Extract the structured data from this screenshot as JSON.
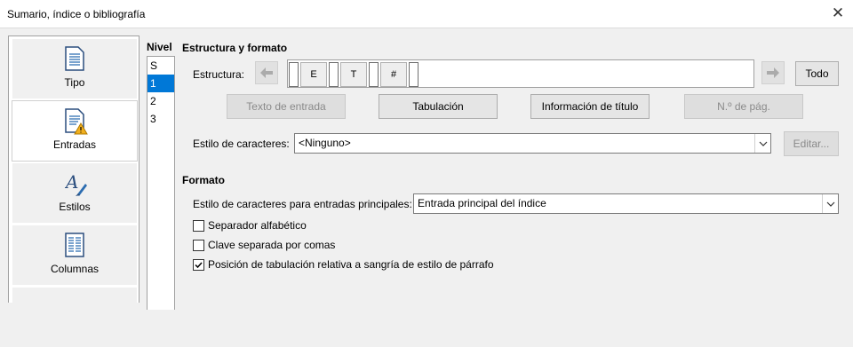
{
  "window": {
    "title": "Sumario, índice o bibliografía",
    "close_glyph": "✕"
  },
  "sidebar": {
    "items": [
      {
        "label": "Tipo",
        "icon": "document-icon"
      },
      {
        "label": "Entradas",
        "icon": "entries-warning-icon"
      },
      {
        "label": "Estilos",
        "icon": "styles-brush-icon"
      },
      {
        "label": "Columnas",
        "icon": "columns-icon"
      }
    ],
    "selected": "Entradas"
  },
  "levels": {
    "header": "Nivel",
    "items": [
      "S",
      "1",
      "2",
      "3"
    ],
    "selected": "1"
  },
  "structure": {
    "section_title": "Estructura y formato",
    "label": "Estructura:",
    "tokens": [
      "E",
      "T",
      "#"
    ],
    "all_button": "Todo",
    "buttons": {
      "entry_text": "Texto de entrada",
      "tab": "Tabulación",
      "chapter_info": "Información de título",
      "page_no": "N.º de pág."
    },
    "char_style_label": "Estilo de caracteres:",
    "char_style_value": "<Ninguno>",
    "edit_button": "Editar..."
  },
  "format": {
    "section_title": "Formato",
    "main_entries_label": "Estilo de caracteres para entradas principales:",
    "main_entries_value": "Entrada principal del índice",
    "options": [
      {
        "label": "Separador alfabético",
        "checked": false
      },
      {
        "label": "Clave separada por comas",
        "checked": false
      },
      {
        "label": "Posición de tabulación relativa a sangría de estilo de párrafo",
        "checked": true
      }
    ]
  }
}
